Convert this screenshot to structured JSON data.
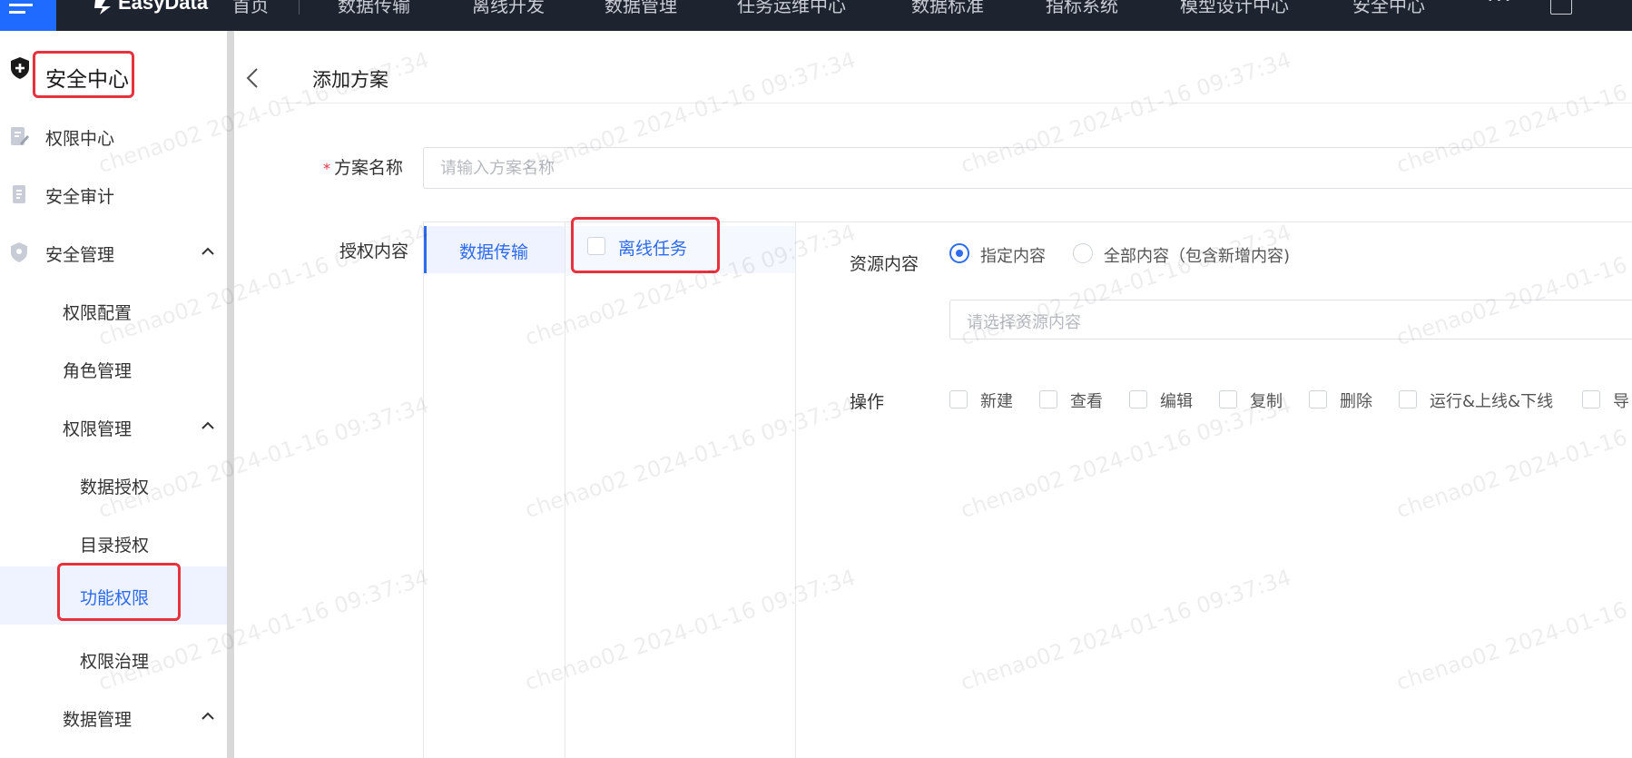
{
  "topnav": {
    "logo": "EasyData",
    "items": [
      "首页",
      "数据传输",
      "离线开发",
      "数据管理",
      "任务运维中心",
      "数据标准",
      "指标系统",
      "模型设计中心",
      "安全中心"
    ],
    "more": "···"
  },
  "sidebar": {
    "title": "安全中心",
    "items": [
      {
        "label": "权限中心"
      },
      {
        "label": "安全审计"
      },
      {
        "label": "安全管理"
      },
      {
        "label": "权限配置"
      },
      {
        "label": "角色管理"
      },
      {
        "label": "权限管理"
      },
      {
        "label": "数据授权"
      },
      {
        "label": "目录授权"
      },
      {
        "label": "功能权限"
      },
      {
        "label": "权限治理"
      },
      {
        "label": "数据管理"
      }
    ]
  },
  "page": {
    "title": "添加方案",
    "name_label": "方案名称",
    "name_required_mark": "*",
    "name_placeholder": "请输入方案名称",
    "auth_label": "授权内容",
    "category": "数据传输",
    "sub_item": "离线任务",
    "resource_label": "资源内容",
    "radio_specified": "指定内容",
    "radio_all": "全部内容（包含新增内容)",
    "resource_placeholder": "请选择资源内容",
    "op_label": "操作",
    "ops": [
      "新建",
      "查看",
      "编辑",
      "复制",
      "删除",
      "运行&上线&下线",
      "导"
    ]
  },
  "watermark": "chenao02 2024-01-16 09:37:34",
  "colors": {
    "accent": "#2d6bf0",
    "highlight_box": "#e8313f",
    "topbar_bg": "#1e2330"
  }
}
